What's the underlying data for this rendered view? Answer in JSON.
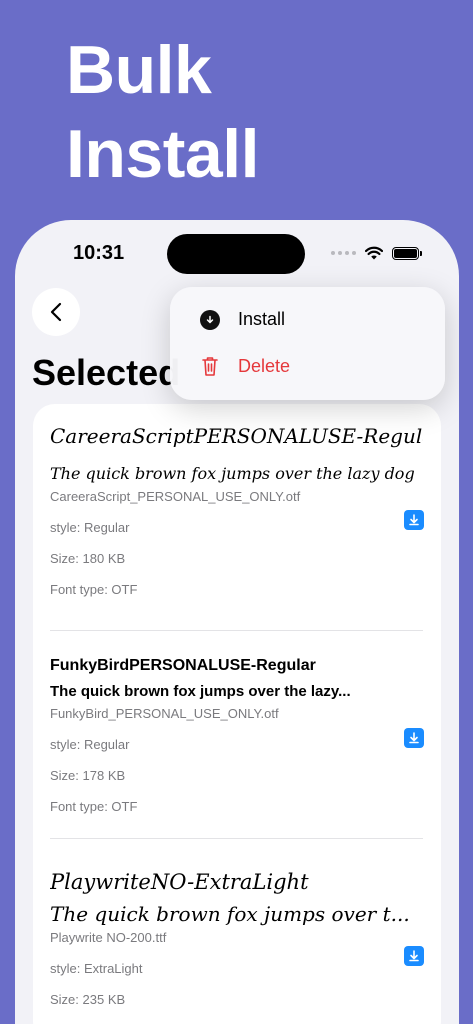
{
  "promo": {
    "line1": "Bulk",
    "line2": "Install"
  },
  "status": {
    "time": "10:31"
  },
  "nav": {
    "title": "Selected"
  },
  "menu": {
    "install_label": "Install",
    "delete_label": "Delete"
  },
  "fonts": [
    {
      "name": "CareeraScriptPERSONALUSE-Regular",
      "sample": "The quick brown fox jumps over the lazy dog",
      "file": "CareeraScript_PERSONAL_USE_ONLY.otf",
      "style": "style: Regular",
      "size": "Size: 180 KB",
      "type": "Font type: OTF"
    },
    {
      "name": "FunkyBirdPERSONALUSE-Regular",
      "sample": "The quick brown fox jumps over the lazy...",
      "file": "FunkyBird_PERSONAL_USE_ONLY.otf",
      "style": "style: Regular",
      "size": "Size: 178 KB",
      "type": "Font type: OTF"
    },
    {
      "name": "PlaywriteNO-ExtraLight",
      "sample": "The quick brown fox jumps over t...",
      "file": "Playwrite NO-200.ttf",
      "style": "style: ExtraLight",
      "size": "Size: 235 KB"
    }
  ],
  "colors": {
    "background": "#6a6dc8",
    "accent": "#1a8cff",
    "destructive": "#e5383b"
  },
  "icons": {
    "back": "chevron-left-icon",
    "install": "download-circle-icon",
    "delete": "trash-icon",
    "item_action": "download-icon"
  }
}
